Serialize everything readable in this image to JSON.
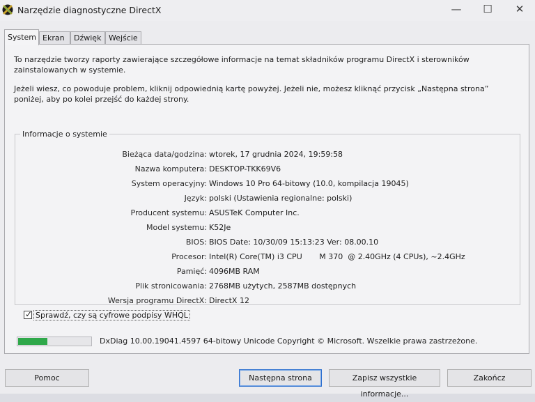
{
  "window": {
    "title": "Narzędzie diagnostyczne DirectX",
    "controls": {
      "minimize": "—",
      "maximize": "☐",
      "close": "✕"
    }
  },
  "tabs": [
    {
      "label": "System",
      "active": true
    },
    {
      "label": "Ekran",
      "active": false
    },
    {
      "label": "Dźwięk",
      "active": false
    },
    {
      "label": "Wejście",
      "active": false
    }
  ],
  "intro": {
    "paragraph1": "To narzędzie tworzy raporty zawierające szczegółowe informacje na temat składników programu DirectX i sterowników zainstalowanych w systemie.",
    "paragraph2": "Jeżeli wiesz, co powoduje problem, kliknij odpowiednią kartę powyżej. Jeżeli nie, możesz kliknąć przycisk „Następna strona” poniżej, aby po kolei przejść do każdej strony."
  },
  "system_info": {
    "group_title": "Informacje o systemie",
    "rows": [
      {
        "label": "Bieżąca data/godzina:",
        "value": "wtorek, 17 grudnia 2024, 19:59:58"
      },
      {
        "label": "Nazwa komputera:",
        "value": "DESKTOP-TKK69V6"
      },
      {
        "label": "System operacyjny:",
        "value": "Windows 10 Pro 64-bitowy (10.0, kompilacja 19045)"
      },
      {
        "label": "Język:",
        "value": "polski (Ustawienia regionalne: polski)"
      },
      {
        "label": "Producent systemu:",
        "value": "ASUSTeK Computer Inc."
      },
      {
        "label": "Model systemu:",
        "value": "K52Je"
      },
      {
        "label": "BIOS:",
        "value": "BIOS Date: 10/30/09 15:13:23 Ver: 08.00.10"
      },
      {
        "label": "Procesor:",
        "value": "Intel(R) Core(TM) i3 CPU       M 370  @ 2.40GHz (4 CPUs), ~2.4GHz"
      },
      {
        "label": "Pamięć:",
        "value": "4096MB RAM"
      },
      {
        "label": "Plik stronicowania:",
        "value": "2768MB użytych, 2587MB dostępnych"
      },
      {
        "label": "Wersja programu DirectX:",
        "value": "DirectX 12"
      }
    ]
  },
  "whql_check": {
    "label": "Sprawdź, czy są cyfrowe podpisy WHQL",
    "checked": true
  },
  "progress": {
    "fraction": 0.4
  },
  "copyright": "DxDiag 10.00.19041.4597 64-bitowy Unicode  Copyright © Microsoft. Wszelkie prawa zastrzeżone.",
  "buttons": {
    "help": "Pomoc",
    "next": "Następna strona",
    "save": "Zapisz wszystkie informacje...",
    "exit": "Zakończ"
  },
  "colors": {
    "progress": "#2fa84a",
    "focus": "#2c6fcf"
  }
}
